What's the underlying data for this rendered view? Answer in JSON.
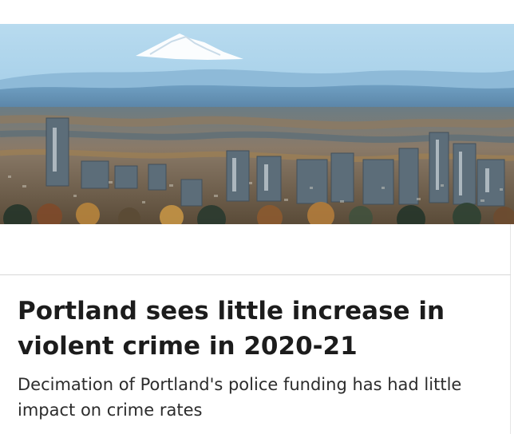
{
  "article": {
    "image": {
      "alt": "",
      "palette": {
        "sky_top": "#b8dbef",
        "sky_bottom": "#7fb3d6",
        "mountain": "#ffffff",
        "ridge": "#5d8fb4",
        "city": "#6f7e8a",
        "foliage": "#b77a3f"
      }
    },
    "headline": "Portland sees little increase in violent crime in 2020-21",
    "dek": "Decimation of Portland's police funding has had little impact on crime rates"
  }
}
